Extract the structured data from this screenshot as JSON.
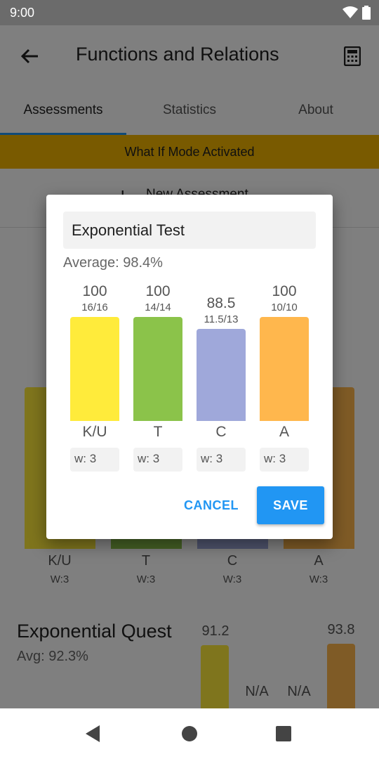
{
  "status": {
    "time": "9:00"
  },
  "app": {
    "title": "Functions and Relations"
  },
  "tabs": [
    {
      "label": "Assessments"
    },
    {
      "label": "Statistics"
    },
    {
      "label": "About"
    }
  ],
  "banner": {
    "text": "What If Mode Activated"
  },
  "new_assessment": {
    "label": "New Assessment"
  },
  "background": {
    "categories": [
      {
        "label": "K/U",
        "weight": "W:3"
      },
      {
        "label": "T",
        "weight": "W:3"
      },
      {
        "label": "C",
        "weight": "W:3"
      },
      {
        "label": "A",
        "weight": "W:3"
      }
    ],
    "quest": {
      "title": "Exponential Quest",
      "avg": "Avg: 92.3%",
      "values": [
        "91.2",
        "N/A",
        "N/A",
        "93.8"
      ]
    },
    "partial_value": "0"
  },
  "dialog": {
    "name": "Exponential Test",
    "average": "Average: 98.4%",
    "bars": [
      {
        "value": "100",
        "fraction": "16/16",
        "category": "K/U",
        "weight": "w: 3",
        "percent": 100,
        "color": "#ffeb3b"
      },
      {
        "value": "100",
        "fraction": "14/14",
        "category": "T",
        "weight": "w: 3",
        "percent": 100,
        "color": "#8bc34a"
      },
      {
        "value": "88.5",
        "fraction": "11.5/13",
        "category": "C",
        "weight": "w: 3",
        "percent": 88.5,
        "color": "#9fa8da"
      },
      {
        "value": "100",
        "fraction": "10/10",
        "category": "A",
        "weight": "w: 3",
        "percent": 100,
        "color": "#ffb74d"
      }
    ],
    "cancel_label": "CANCEL",
    "save_label": "SAVE"
  }
}
